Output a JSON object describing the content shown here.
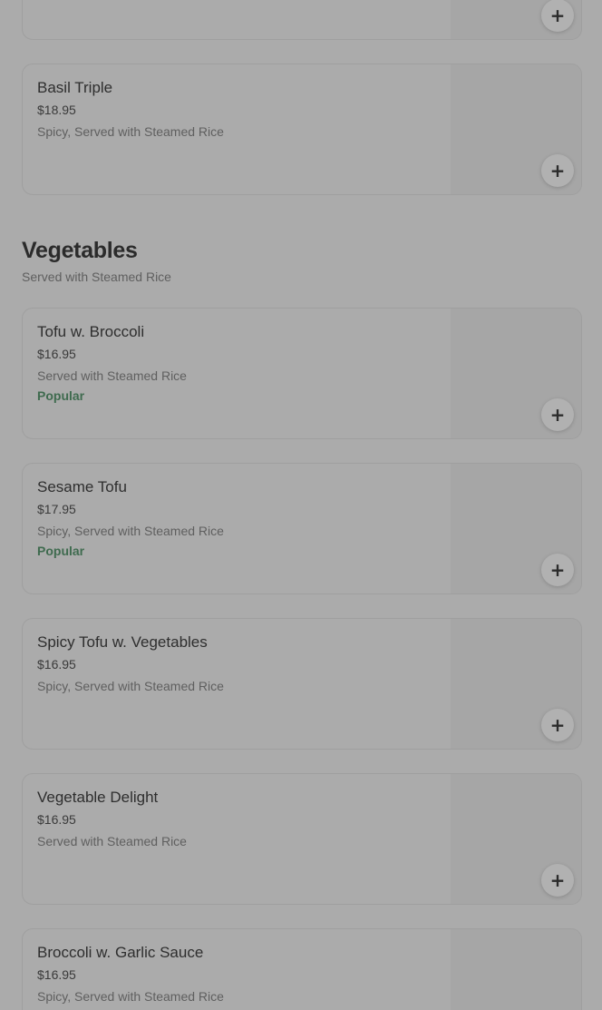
{
  "top_card": {
    "add_icon": "plus-icon",
    "add_glyph": "+"
  },
  "basil_card": {
    "name": "Basil Triple",
    "price": "$18.95",
    "description": "Spicy, Served with Steamed Rice",
    "add_glyph": "+"
  },
  "vegetables_section": {
    "title": "Vegetables",
    "subtitle": "Served with Steamed Rice",
    "items": [
      {
        "name": "Tofu w. Broccoli",
        "price": "$16.95",
        "description": "Served with Steamed Rice",
        "tag": "Popular",
        "add_glyph": "+"
      },
      {
        "name": "Sesame Tofu",
        "price": "$17.95",
        "description": "Spicy, Served with Steamed Rice",
        "tag": "Popular",
        "add_glyph": "+"
      },
      {
        "name": "Spicy Tofu w. Vegetables",
        "price": "$16.95",
        "description": "Spicy, Served with Steamed Rice",
        "add_glyph": "+"
      },
      {
        "name": "Vegetable Delight",
        "price": "$16.95",
        "description": "Served with Steamed Rice",
        "add_glyph": "+"
      },
      {
        "name": "Broccoli w. Garlic Sauce",
        "price": "$16.95",
        "description": "Spicy, Served with Steamed Rice",
        "add_glyph": "+"
      }
    ]
  },
  "colors": {
    "overlay_background": "#ababab",
    "popular_tag": "#3f6b4f",
    "text_primary": "#2b2b2b",
    "text_secondary": "#5f5f5f"
  }
}
